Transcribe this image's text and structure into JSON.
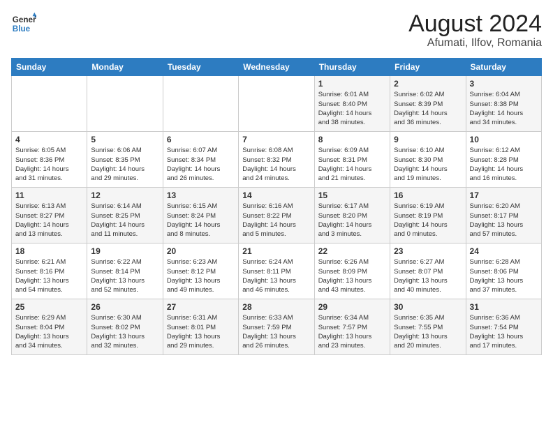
{
  "header": {
    "logo_line1": "General",
    "logo_line2": "Blue",
    "title": "August 2024",
    "subtitle": "Afumati, Ilfov, Romania"
  },
  "days_of_week": [
    "Sunday",
    "Monday",
    "Tuesday",
    "Wednesday",
    "Thursday",
    "Friday",
    "Saturday"
  ],
  "weeks": [
    [
      {
        "day": "",
        "info": ""
      },
      {
        "day": "",
        "info": ""
      },
      {
        "day": "",
        "info": ""
      },
      {
        "day": "",
        "info": ""
      },
      {
        "day": "1",
        "info": "Sunrise: 6:01 AM\nSunset: 8:40 PM\nDaylight: 14 hours\nand 38 minutes."
      },
      {
        "day": "2",
        "info": "Sunrise: 6:02 AM\nSunset: 8:39 PM\nDaylight: 14 hours\nand 36 minutes."
      },
      {
        "day": "3",
        "info": "Sunrise: 6:04 AM\nSunset: 8:38 PM\nDaylight: 14 hours\nand 34 minutes."
      }
    ],
    [
      {
        "day": "4",
        "info": "Sunrise: 6:05 AM\nSunset: 8:36 PM\nDaylight: 14 hours\nand 31 minutes."
      },
      {
        "day": "5",
        "info": "Sunrise: 6:06 AM\nSunset: 8:35 PM\nDaylight: 14 hours\nand 29 minutes."
      },
      {
        "day": "6",
        "info": "Sunrise: 6:07 AM\nSunset: 8:34 PM\nDaylight: 14 hours\nand 26 minutes."
      },
      {
        "day": "7",
        "info": "Sunrise: 6:08 AM\nSunset: 8:32 PM\nDaylight: 14 hours\nand 24 minutes."
      },
      {
        "day": "8",
        "info": "Sunrise: 6:09 AM\nSunset: 8:31 PM\nDaylight: 14 hours\nand 21 minutes."
      },
      {
        "day": "9",
        "info": "Sunrise: 6:10 AM\nSunset: 8:30 PM\nDaylight: 14 hours\nand 19 minutes."
      },
      {
        "day": "10",
        "info": "Sunrise: 6:12 AM\nSunset: 8:28 PM\nDaylight: 14 hours\nand 16 minutes."
      }
    ],
    [
      {
        "day": "11",
        "info": "Sunrise: 6:13 AM\nSunset: 8:27 PM\nDaylight: 14 hours\nand 13 minutes."
      },
      {
        "day": "12",
        "info": "Sunrise: 6:14 AM\nSunset: 8:25 PM\nDaylight: 14 hours\nand 11 minutes."
      },
      {
        "day": "13",
        "info": "Sunrise: 6:15 AM\nSunset: 8:24 PM\nDaylight: 14 hours\nand 8 minutes."
      },
      {
        "day": "14",
        "info": "Sunrise: 6:16 AM\nSunset: 8:22 PM\nDaylight: 14 hours\nand 5 minutes."
      },
      {
        "day": "15",
        "info": "Sunrise: 6:17 AM\nSunset: 8:20 PM\nDaylight: 14 hours\nand 3 minutes."
      },
      {
        "day": "16",
        "info": "Sunrise: 6:19 AM\nSunset: 8:19 PM\nDaylight: 14 hours\nand 0 minutes."
      },
      {
        "day": "17",
        "info": "Sunrise: 6:20 AM\nSunset: 8:17 PM\nDaylight: 13 hours\nand 57 minutes."
      }
    ],
    [
      {
        "day": "18",
        "info": "Sunrise: 6:21 AM\nSunset: 8:16 PM\nDaylight: 13 hours\nand 54 minutes."
      },
      {
        "day": "19",
        "info": "Sunrise: 6:22 AM\nSunset: 8:14 PM\nDaylight: 13 hours\nand 52 minutes."
      },
      {
        "day": "20",
        "info": "Sunrise: 6:23 AM\nSunset: 8:12 PM\nDaylight: 13 hours\nand 49 minutes."
      },
      {
        "day": "21",
        "info": "Sunrise: 6:24 AM\nSunset: 8:11 PM\nDaylight: 13 hours\nand 46 minutes."
      },
      {
        "day": "22",
        "info": "Sunrise: 6:26 AM\nSunset: 8:09 PM\nDaylight: 13 hours\nand 43 minutes."
      },
      {
        "day": "23",
        "info": "Sunrise: 6:27 AM\nSunset: 8:07 PM\nDaylight: 13 hours\nand 40 minutes."
      },
      {
        "day": "24",
        "info": "Sunrise: 6:28 AM\nSunset: 8:06 PM\nDaylight: 13 hours\nand 37 minutes."
      }
    ],
    [
      {
        "day": "25",
        "info": "Sunrise: 6:29 AM\nSunset: 8:04 PM\nDaylight: 13 hours\nand 34 minutes."
      },
      {
        "day": "26",
        "info": "Sunrise: 6:30 AM\nSunset: 8:02 PM\nDaylight: 13 hours\nand 32 minutes."
      },
      {
        "day": "27",
        "info": "Sunrise: 6:31 AM\nSunset: 8:01 PM\nDaylight: 13 hours\nand 29 minutes."
      },
      {
        "day": "28",
        "info": "Sunrise: 6:33 AM\nSunset: 7:59 PM\nDaylight: 13 hours\nand 26 minutes."
      },
      {
        "day": "29",
        "info": "Sunrise: 6:34 AM\nSunset: 7:57 PM\nDaylight: 13 hours\nand 23 minutes."
      },
      {
        "day": "30",
        "info": "Sunrise: 6:35 AM\nSunset: 7:55 PM\nDaylight: 13 hours\nand 20 minutes."
      },
      {
        "day": "31",
        "info": "Sunrise: 6:36 AM\nSunset: 7:54 PM\nDaylight: 13 hours\nand 17 minutes."
      }
    ]
  ]
}
